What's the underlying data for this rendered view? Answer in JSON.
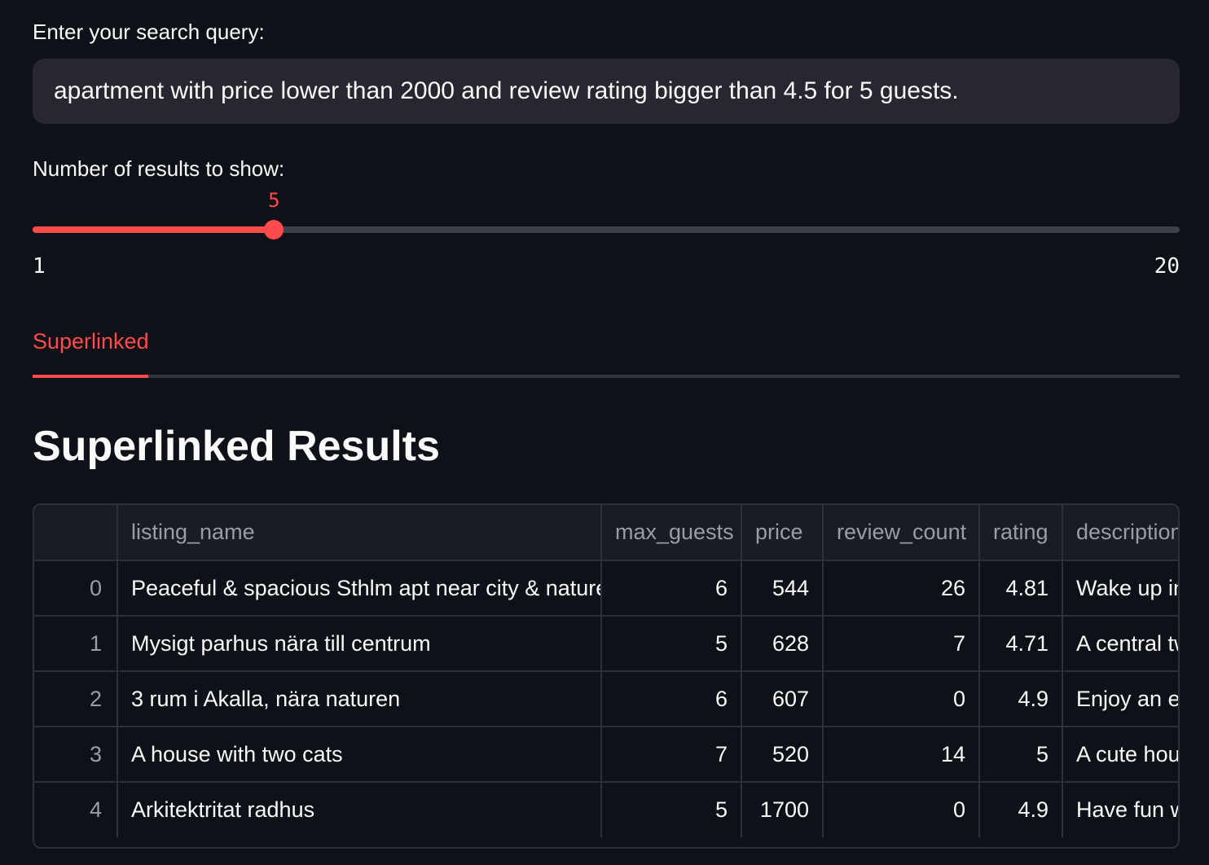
{
  "search": {
    "label": "Enter your search query:",
    "value": "apartment with price lower than 2000 and review rating bigger than 4.5 for 5 guests."
  },
  "slider": {
    "label": "Number of results to show:",
    "value": 5,
    "value_text": "5",
    "min": 1,
    "max": 20,
    "min_text": "1",
    "max_text": "20"
  },
  "tabs": [
    {
      "label": "Superlinked",
      "active": true
    }
  ],
  "results": {
    "title": "Superlinked Results",
    "columns": [
      "",
      "listing_name",
      "max_guests",
      "price",
      "review_count",
      "rating",
      "description"
    ],
    "rows": [
      [
        "0",
        "Peaceful & spacious Sthlm apt near city & nature",
        "6",
        "544",
        "26",
        "4.81",
        "Wake up in"
      ],
      [
        "1",
        "Mysigt parhus nära till centrum",
        "5",
        "628",
        "7",
        "4.71",
        "A central tw"
      ],
      [
        "2",
        "3 rum i Akalla, nära naturen",
        "6",
        "607",
        "0",
        "4.9",
        "Enjoy an el"
      ],
      [
        "3",
        "A house with two cats",
        "7",
        "520",
        "14",
        "5",
        "A cute hous"
      ],
      [
        "4",
        "Arkitektritat radhus",
        "5",
        "1700",
        "0",
        "4.9",
        "Have fun w"
      ]
    ]
  },
  "colors": {
    "accent": "#ff4b4b",
    "background": "#0e1117",
    "input_bg": "#262730"
  }
}
